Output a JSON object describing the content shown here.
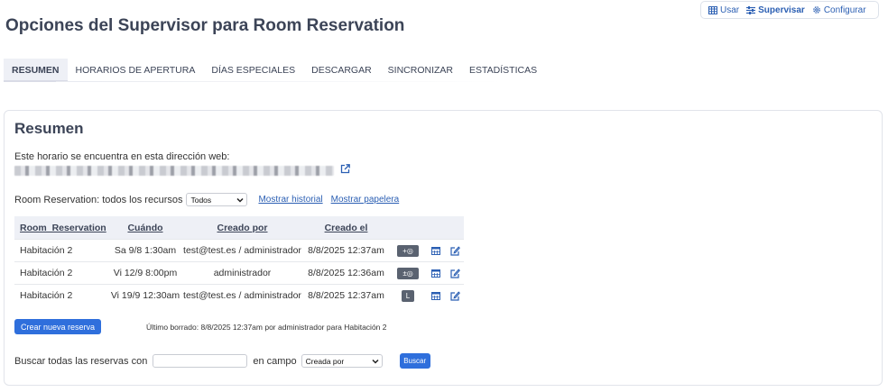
{
  "topnav": {
    "use": "Usar",
    "supervise": "Supervisar",
    "configure": "Configurar"
  },
  "page_title": "Opciones del Supervisor para Room Reservation",
  "tabs": [
    "RESUMEN",
    "HORARIOS DE APERTURA",
    "DÍAS ESPECIALES",
    "DESCARGAR",
    "SINCRONIZAR",
    "ESTADÍSTICAS"
  ],
  "summary": {
    "heading": "Resumen",
    "url_intro": "Este horario se encuentra en esta dirección web:",
    "filter_label": "Room Reservation: todos los recursos",
    "filter_value": "Todos",
    "show_history": "Mostrar historial",
    "show_trash": "Mostrar papelera"
  },
  "table": {
    "headers": [
      "Room_Reservation",
      "Cuándo",
      "Creado por",
      "Creado el"
    ],
    "rows": [
      {
        "room": "Habitación 2",
        "when": "Sa 9/8 1:30am",
        "by": "test@test.es / administrador",
        "on": "8/8/2025 12:37am",
        "badge": "+◎"
      },
      {
        "room": "Habitación 2",
        "when": "Vi 12/9 8:00pm",
        "by": "administrador",
        "on": "8/8/2025 12:36am",
        "badge": "±◎"
      },
      {
        "room": "Habitación 2",
        "when": "Vi 19/9 12:30am",
        "by": "test@test.es / administrador",
        "on": "8/8/2025 12:37am",
        "badge": "L"
      }
    ]
  },
  "create_button": "Crear nueva reserva",
  "last_deleted": "Último borrado: 8/8/2025 12:37am por administrador para Habitación 2",
  "search": {
    "label_before": "Buscar todas las reservas con",
    "input_value": "",
    "label_after": "en campo",
    "field_value": "Creada por",
    "button": "Buscar"
  },
  "colors": {
    "accent": "#2f6fdc",
    "link": "#2b5fb3",
    "badge": "#5a6270",
    "header_bg": "#eef0f6"
  },
  "icons": {
    "use": "table-icon",
    "supervise": "sliders-icon",
    "configure": "gear-icon",
    "external": "external-link-icon",
    "calendar": "calendar-icon",
    "edit": "edit-icon"
  }
}
